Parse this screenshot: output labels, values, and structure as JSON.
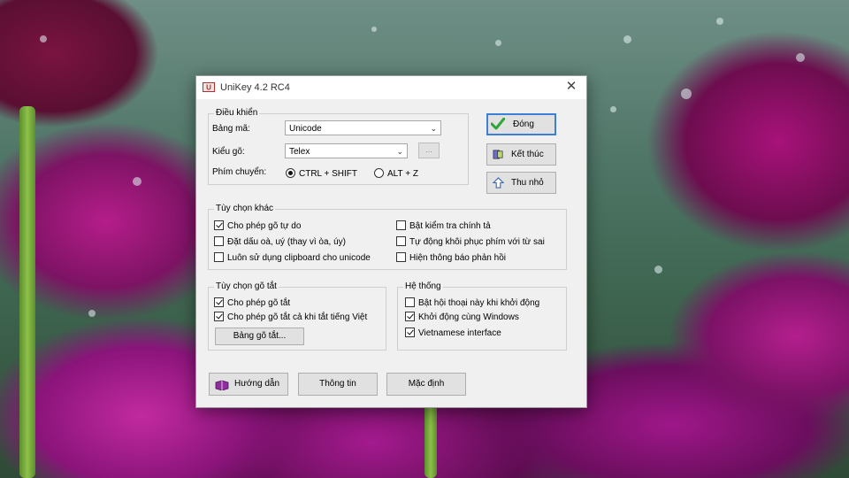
{
  "window": {
    "title": "UniKey 4.2 RC4"
  },
  "controls": {
    "legend": "Điều khiển",
    "charset_label": "Bảng mã:",
    "charset_value": "Unicode",
    "method_label": "Kiểu gõ:",
    "method_value": "Telex",
    "method_extra": "...",
    "switch_label": "Phím chuyển:",
    "switch_options": [
      {
        "label": "CTRL + SHIFT",
        "selected": true
      },
      {
        "label": "ALT + Z",
        "selected": false
      }
    ]
  },
  "side_buttons": {
    "close": "Đóng",
    "exit": "Kết thúc",
    "minimize": "Thu nhỏ"
  },
  "other_options": {
    "legend": "Tùy chọn khác",
    "items": [
      {
        "label": "Cho phép gõ tự do",
        "checked": true
      },
      {
        "label": "Đặt dấu oà, uý (thay vì òa, úy)",
        "checked": false
      },
      {
        "label": "Luôn sử dụng clipboard cho unicode",
        "checked": false
      },
      {
        "label": "Bật kiểm tra chính tả",
        "checked": false
      },
      {
        "label": "Tự động khôi phục phím với từ sai",
        "checked": false
      },
      {
        "label": "Hiện thông báo phản hồi",
        "checked": false
      }
    ]
  },
  "shortcut": {
    "legend": "Tùy chọn gõ tắt",
    "items": [
      {
        "label": "Cho phép gõ tắt",
        "checked": true
      },
      {
        "label": "Cho phép gõ tắt cả khi tắt tiếng Việt",
        "checked": true
      }
    ],
    "table_button": "Bảng gõ tắt..."
  },
  "system": {
    "legend": "Hệ thống",
    "items": [
      {
        "label": "Bật hội thoại này khi khởi động",
        "checked": false
      },
      {
        "label": "Khởi động cùng Windows",
        "checked": true
      },
      {
        "label": "Vietnamese interface",
        "checked": true
      }
    ]
  },
  "bottom_buttons": {
    "guide": "Hướng dẫn",
    "info": "Thông tin",
    "default": "Mặc định"
  },
  "colors": {
    "primary_border": "#3c7fd6",
    "check_green": "#2fa43a"
  }
}
